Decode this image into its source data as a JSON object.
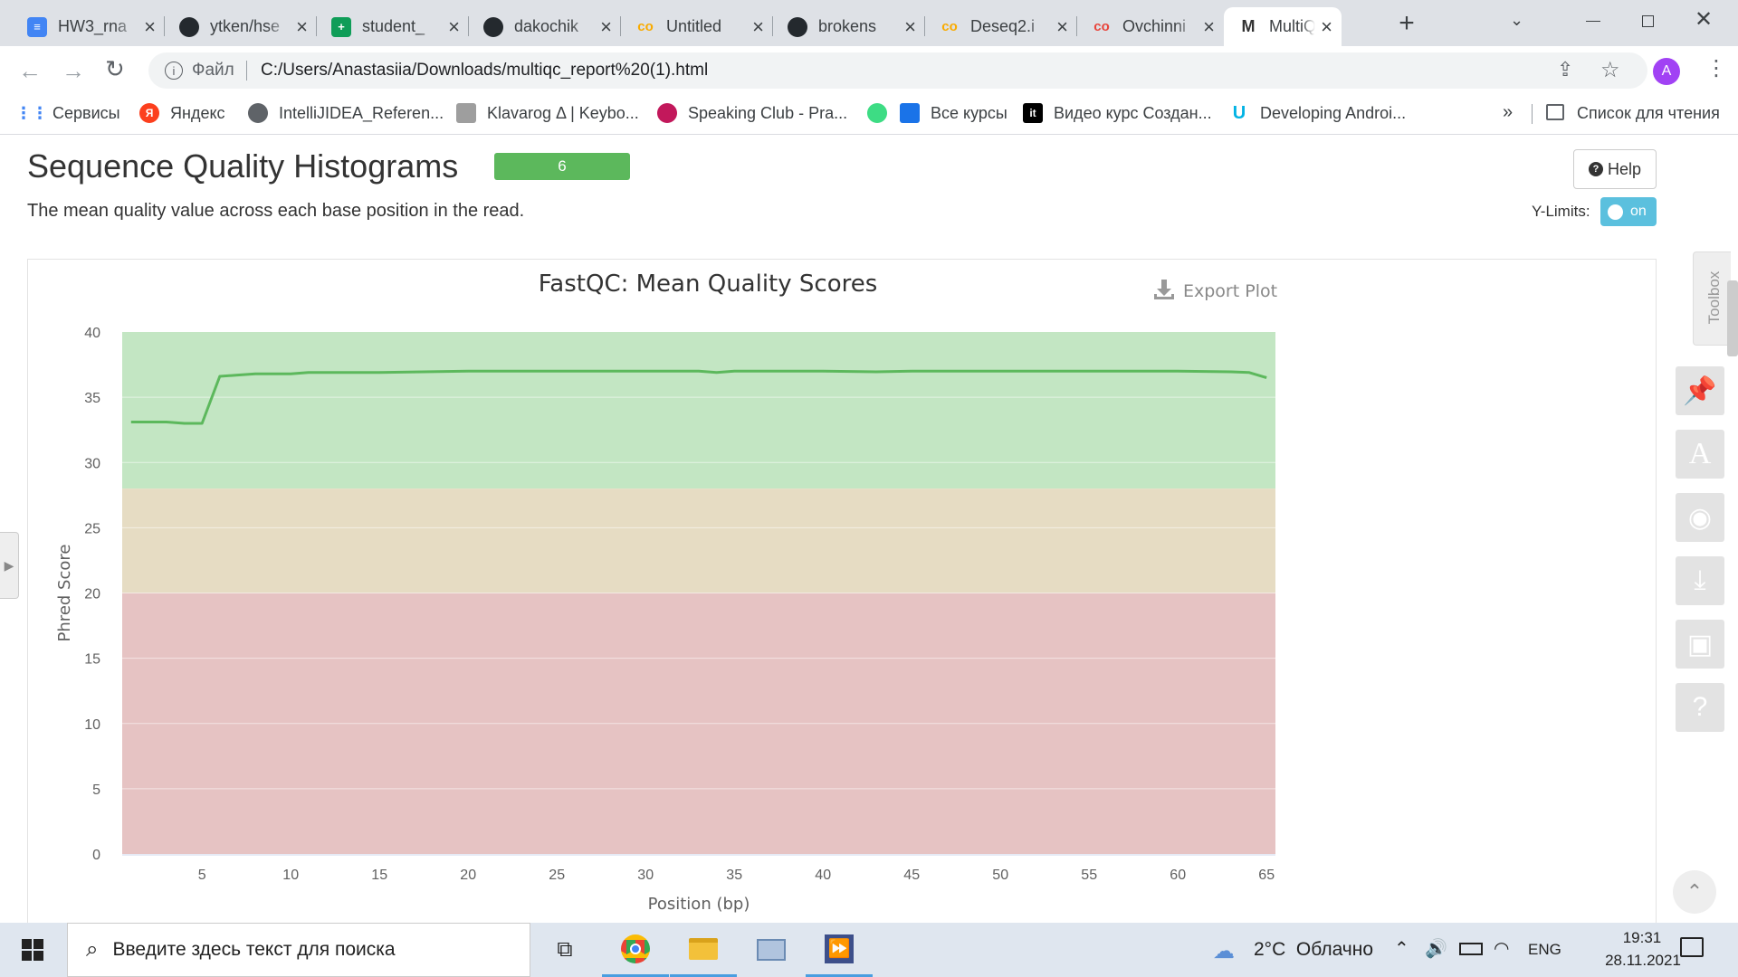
{
  "browser": {
    "tabs": [
      {
        "title": "HW3_rna",
        "icon": "google-docs-icon",
        "color": "#4285f4",
        "glyph": "≡"
      },
      {
        "title": "ytken/hse",
        "icon": "github-icon",
        "color": "#24292e",
        "glyph": ""
      },
      {
        "title": "student_",
        "icon": "google-sheets-icon",
        "color": "#0f9d58",
        "glyph": "+"
      },
      {
        "title": "dakochik",
        "icon": "github-icon",
        "color": "#24292e",
        "glyph": ""
      },
      {
        "title": "Untitled",
        "icon": "colab-icon",
        "color": "#f9ab00",
        "glyph": "co"
      },
      {
        "title": "brokens",
        "icon": "github-icon",
        "color": "#24292e",
        "glyph": ""
      },
      {
        "title": "Deseq2.i",
        "icon": "colab-icon",
        "color": "#f9ab00",
        "glyph": "co"
      },
      {
        "title": "Ovchinni",
        "icon": "colab-icon",
        "color": "#e8453c",
        "glyph": "co"
      },
      {
        "title": "MultiQC",
        "icon": "multiqc-icon",
        "color": "#333333",
        "glyph": "M",
        "active": true
      }
    ],
    "address": {
      "label": "Файл",
      "url": "C:/Users/Anastasiia/Downloads/multiqc_report%20(1).html"
    },
    "profile_initial": "A",
    "bookmarks": [
      {
        "label": "Сервисы",
        "icon": "apps-grid-icon",
        "color": "#4285f4"
      },
      {
        "label": "Яндекс",
        "icon": "yandex-icon",
        "color": "#fc3f1d"
      },
      {
        "label": "IntelliJIDEA_Referen...",
        "icon": "globe-icon",
        "color": "#5f6368"
      },
      {
        "label": "Klavarog Δ | Keybo...",
        "icon": "klavarog-icon",
        "color": "#9e9e9e"
      },
      {
        "label": "Speaking Club - Pra...",
        "icon": "speaking-club-icon",
        "color": "#c2185b"
      },
      {
        "label": "",
        "icon": "android-icon",
        "color": "#3ddc84"
      },
      {
        "label": "Все курсы",
        "icon": "stepik-icon",
        "color": "#1a73e8"
      },
      {
        "label": "Видео курс Создан...",
        "icon": "itproger-icon",
        "color": "#000000"
      },
      {
        "label": "Developing Androi...",
        "icon": "udacity-icon",
        "color": "#02b3e4"
      }
    ],
    "reading_list": "Список для чтения",
    "more": "»"
  },
  "section": {
    "title": "Sequence Quality Histograms",
    "badge": "6",
    "description": "The mean quality value across each base position in the read.",
    "help_label": "Help",
    "ylimits_label": "Y-Limits:",
    "ylimits_toggle": "on",
    "toolbox_label": "Toolbox"
  },
  "chart_data": {
    "type": "line",
    "title": "FastQC: Mean Quality Scores",
    "export_label": "Export Plot",
    "xlabel": "Position (bp)",
    "ylabel": "Phred Score",
    "xlim": [
      0.5,
      65.5
    ],
    "ylim": [
      0,
      40
    ],
    "xticks": [
      5,
      10,
      15,
      20,
      25,
      30,
      35,
      40,
      45,
      50,
      55,
      60,
      65
    ],
    "yticks": [
      0,
      5,
      10,
      15,
      20,
      25,
      30,
      35,
      40
    ],
    "bands": [
      {
        "from": 28,
        "to": 40,
        "color": "#c3e6c3"
      },
      {
        "from": 20,
        "to": 28,
        "color": "#e6dcc3"
      },
      {
        "from": 0,
        "to": 20,
        "color": "#e6c3c3"
      }
    ],
    "series": [
      {
        "color": "#5cb85c",
        "x": [
          1,
          2,
          3,
          4,
          5,
          6,
          7,
          8,
          9,
          10,
          11,
          12,
          15,
          20,
          25,
          30,
          33,
          34,
          35,
          40,
          43,
          45,
          50,
          55,
          60,
          63,
          64,
          65
        ],
        "y": [
          33.1,
          33.1,
          33.1,
          33.0,
          33.0,
          36.6,
          36.7,
          36.8,
          36.8,
          36.8,
          36.9,
          36.9,
          36.9,
          37.0,
          37.0,
          37.0,
          37.0,
          36.9,
          37.0,
          37.0,
          36.95,
          37.0,
          37.0,
          37.0,
          37.0,
          36.95,
          36.9,
          36.5
        ]
      }
    ]
  },
  "taskbar": {
    "search_placeholder": "Введите здесь текст для поиска",
    "weather": "2°C  Облачно",
    "lang": "ENG",
    "time": "19:31",
    "date": "28.11.2021"
  }
}
